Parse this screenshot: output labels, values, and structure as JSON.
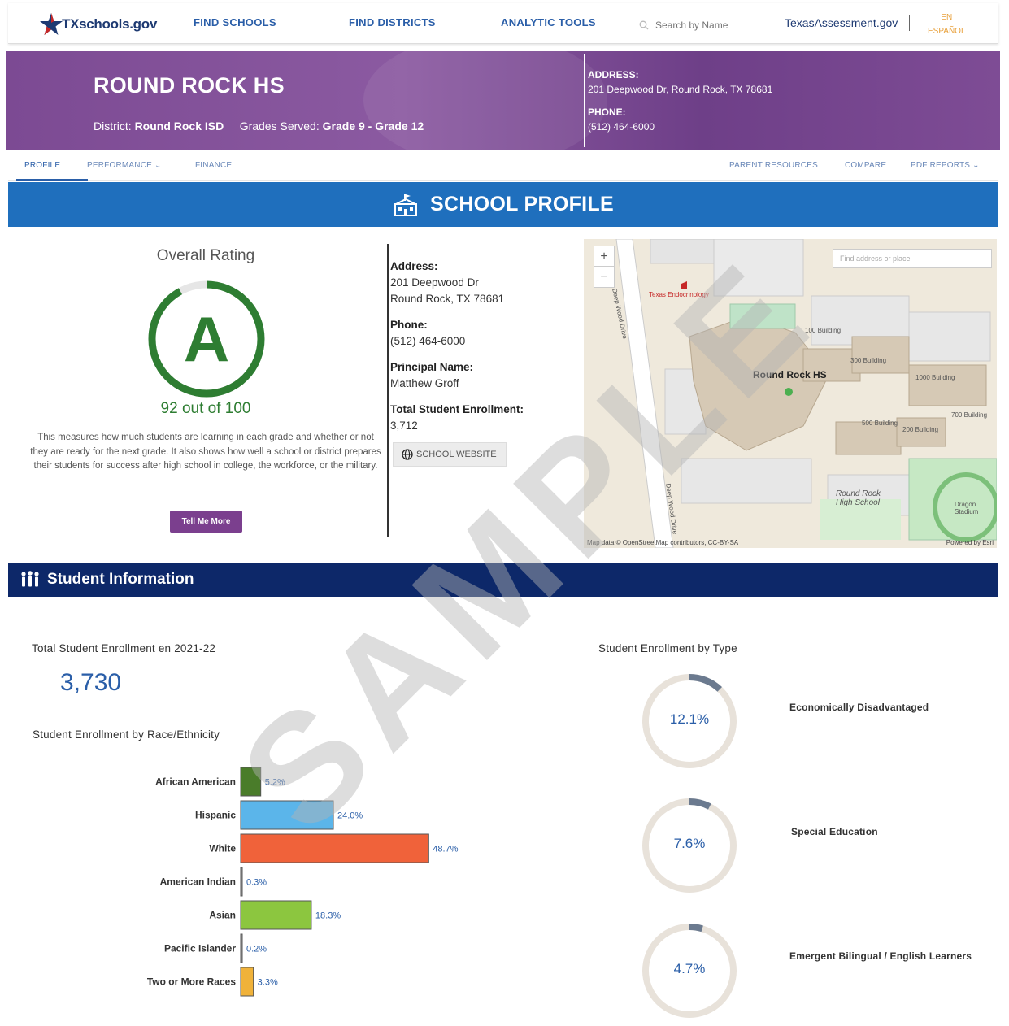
{
  "header": {
    "logo_text": "TXschools.gov",
    "nav": [
      "FIND SCHOOLS",
      "FIND DISTRICTS",
      "ANALYTIC TOOLS"
    ],
    "search_placeholder": "Search by Name",
    "assessment_link": "TexasAssessment.gov",
    "lang_en": "EN",
    "lang_es": "ESPAÑOL"
  },
  "banner": {
    "school_name": "ROUND ROCK HS",
    "district_label": "District:",
    "district_value": "Round Rock ISD",
    "grades_label": "Grades Served:",
    "grades_value": "Grade 9 - Grade 12",
    "address_label": "ADDRESS:",
    "address_value": "201 Deepwood Dr, Round Rock, TX 78681",
    "phone_label": "PHONE:",
    "phone_value": "(512) 464-6000"
  },
  "subnav": {
    "profile": "PROFILE",
    "performance": "PERFORMANCE",
    "finance": "FINANCE",
    "parent_resources": "PARENT RESOURCES",
    "compare": "COMPARE",
    "pdf_reports": "PDF REPORTS"
  },
  "profile_bar": {
    "title": "SCHOOL PROFILE"
  },
  "rating": {
    "title": "Overall Rating",
    "grade": "A",
    "score_text": "92 out of 100",
    "score": 92,
    "max": 100,
    "description": "This measures how much students are learning in each grade and whether or not they are ready for the next grade. It also shows how well a school or district prepares their students for success after high school in college, the workforce, or the military.",
    "button": "Tell Me More",
    "color": "#2e7d32"
  },
  "info": {
    "address_label": "Address:",
    "address_line1": "201 Deepwood Dr",
    "address_line2": "Round Rock, TX 78681",
    "phone_label": "Phone:",
    "phone_value": "(512) 464-6000",
    "principal_label": "Principal Name:",
    "principal_value": "Matthew Groff",
    "enrollment_label": "Total Student Enrollment:",
    "enrollment_value": "3,712",
    "website_button": "SCHOOL WEBSITE"
  },
  "map": {
    "search_placeholder": "Find address or place",
    "main_label": "Round Rock HS",
    "street_1": "Deep Wood Drive",
    "street_2": "Deep Wood Drive",
    "poi": "Texas Endocrinology",
    "buildings": [
      "100 Building",
      "300 Building",
      "500 Building",
      "700 Building",
      "200 Building",
      "1000 Building"
    ],
    "school_label": "Round Rock High School",
    "stadium": "Dragon Stadium",
    "attribution": "Map data © OpenStreetMap contributors, CC-BY-SA",
    "powered": "Powered by Esri"
  },
  "student_info": {
    "title": "Student Information",
    "enrollment_title": "Total Student Enrollment en 2021-22",
    "enrollment_value": "3,730",
    "race_title": "Student Enrollment by Race/Ethnicity",
    "type_title": "Student Enrollment by Type"
  },
  "chart_data": [
    {
      "type": "bar",
      "orientation": "horizontal",
      "title": "Student Enrollment by Race/Ethnicity",
      "categories": [
        "African American",
        "Hispanic",
        "White",
        "American Indian",
        "Asian",
        "Pacific Islander",
        "Two or More Races"
      ],
      "values": [
        5.2,
        24.0,
        48.7,
        0.3,
        18.3,
        0.2,
        3.3
      ],
      "labels": [
        "5.2%",
        "24.0%",
        "48.7%",
        "0.3%",
        "18.3%",
        "0.2%",
        "3.3%"
      ],
      "colors": [
        "#4a7c2a",
        "#5bb5ea",
        "#f0623a",
        "#8a8a8a",
        "#8cc63f",
        "#8a8a8a",
        "#f0b23a"
      ],
      "xlim": [
        0,
        100
      ]
    },
    {
      "type": "pie",
      "title": "Student Enrollment by Type",
      "categories": [
        "Economically Disadvantaged",
        "Special Education",
        "Emergent Bilingual / English Learners"
      ],
      "values": [
        12.1,
        7.6,
        4.7
      ],
      "labels": [
        "12.1%",
        "7.6%",
        "4.7%"
      ],
      "fill_color": "#6b7a8f",
      "track_color": "#e8e2da"
    }
  ],
  "watermark": "SAMPLE"
}
